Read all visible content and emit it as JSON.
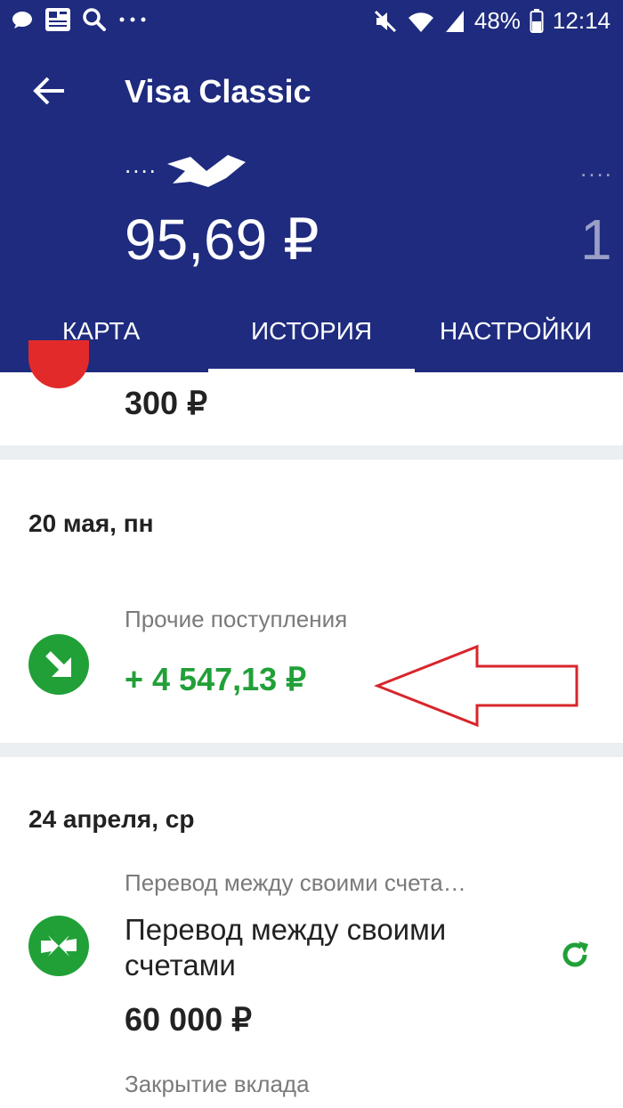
{
  "status_bar": {
    "battery": "48%",
    "time": "12:14"
  },
  "header": {
    "title": "Visa Classic",
    "card_mask": "....",
    "balance": "95,69 ₽",
    "next_card_dots": "....",
    "next_card_balance": "1"
  },
  "tabs": [
    {
      "label": "КАРТА"
    },
    {
      "label": "ИСТОРИЯ"
    },
    {
      "label": "НАСТРОЙКИ"
    }
  ],
  "history": {
    "prev_amount": "300 ₽",
    "groups": [
      {
        "date": "20 мая, пн",
        "items": [
          {
            "category": "Прочие поступления",
            "amount": "+ 4 547,13 ₽"
          }
        ]
      },
      {
        "date": "24 апреля, ср",
        "items": [
          {
            "category": "Перевод между своими счета…",
            "name": "Перевод между своими счетами",
            "amount": "60 000 ₽"
          },
          {
            "category": "Закрытие вклада"
          }
        ]
      }
    ]
  },
  "colors": {
    "header_bg": "#1e2b7e",
    "accent_green": "#21a038",
    "annotation_red": "#d8262b"
  }
}
